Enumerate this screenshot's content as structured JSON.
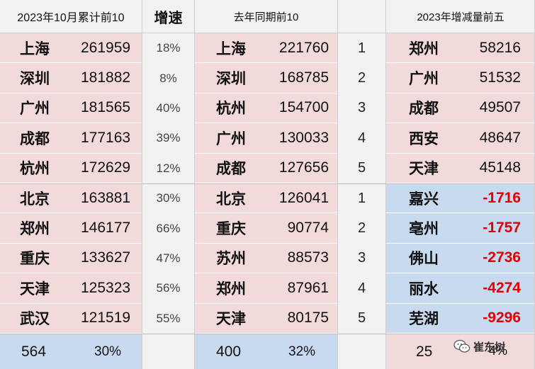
{
  "headers": {
    "col1": "2023年10月累计前10",
    "col2": "增速",
    "col3": "去年同期前10",
    "col5": "2023年增减量前五"
  },
  "top2023": [
    {
      "city": "上海",
      "value": "261959",
      "growth": "18%"
    },
    {
      "city": "深圳",
      "value": "181882",
      "growth": "8%"
    },
    {
      "city": "广州",
      "value": "181565",
      "growth": "40%"
    },
    {
      "city": "成都",
      "value": "177163",
      "growth": "39%"
    },
    {
      "city": "杭州",
      "value": "172629",
      "growth": "12%"
    },
    {
      "city": "北京",
      "value": "163881",
      "growth": "30%"
    },
    {
      "city": "郑州",
      "value": "146177",
      "growth": "66%"
    },
    {
      "city": "重庆",
      "value": "133627",
      "growth": "47%"
    },
    {
      "city": "天津",
      "value": "125323",
      "growth": "56%"
    },
    {
      "city": "武汉",
      "value": "121519",
      "growth": "55%"
    }
  ],
  "top2022": [
    {
      "city": "上海",
      "value": "221760",
      "rank": "1"
    },
    {
      "city": "深圳",
      "value": "168785",
      "rank": "2"
    },
    {
      "city": "杭州",
      "value": "154700",
      "rank": "3"
    },
    {
      "city": "广州",
      "value": "130033",
      "rank": "4"
    },
    {
      "city": "成都",
      "value": "127656",
      "rank": "5"
    },
    {
      "city": "北京",
      "value": "126041",
      "rank": "1"
    },
    {
      "city": "重庆",
      "value": "90774",
      "rank": "2"
    },
    {
      "city": "苏州",
      "value": "88573",
      "rank": "3"
    },
    {
      "city": "郑州",
      "value": "87961",
      "rank": "4"
    },
    {
      "city": "天津",
      "value": "80175",
      "rank": "5"
    }
  ],
  "change": [
    {
      "city": "郑州",
      "value": "58216"
    },
    {
      "city": "广州",
      "value": "51532"
    },
    {
      "city": "成都",
      "value": "49507"
    },
    {
      "city": "西安",
      "value": "48647"
    },
    {
      "city": "天津",
      "value": "45148"
    },
    {
      "city": "嘉兴",
      "value": "-1716"
    },
    {
      "city": "亳州",
      "value": "-1757"
    },
    {
      "city": "佛山",
      "value": "-2736"
    },
    {
      "city": "丽水",
      "value": "-4274"
    },
    {
      "city": "芜湖",
      "value": "-9296"
    }
  ],
  "footer": {
    "count2023": "564",
    "pct2023": "30%",
    "count2022": "400",
    "pct2022": "32%",
    "changeCount": "25",
    "changePct": "4%"
  },
  "watermark": {
    "text": "崔东树",
    "icon": "wechat-icon"
  },
  "colors": {
    "pink": "#f2d9da",
    "blue": "#c8daf0",
    "header": "#f2f2f2",
    "negative": "#e00000"
  }
}
